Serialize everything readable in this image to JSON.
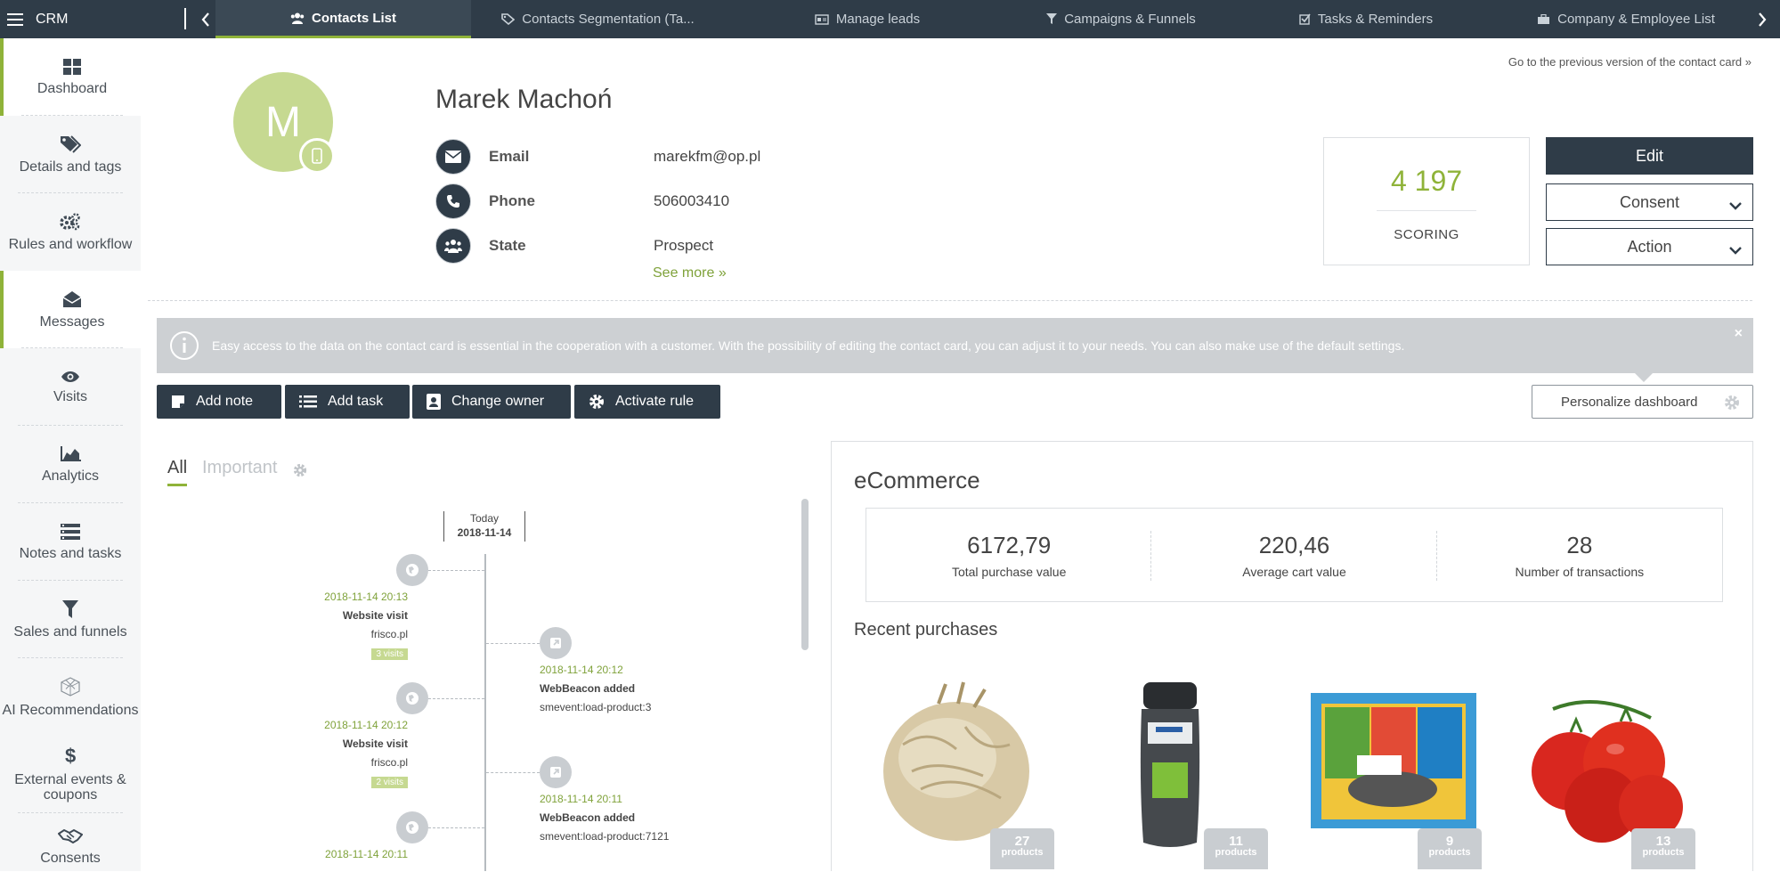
{
  "topbar": {
    "brand": "CRM",
    "tabs": [
      {
        "label": "Contacts List",
        "icon": "users-icon",
        "active": true
      },
      {
        "label": "Contacts Segmentation (Ta...",
        "icon": "tags-icon",
        "active": false
      },
      {
        "label": "Manage leads",
        "icon": "id-card-icon",
        "active": false
      },
      {
        "label": "Campaigns & Funnels",
        "icon": "filter-icon",
        "active": false
      },
      {
        "label": "Tasks & Reminders",
        "icon": "checkbox-icon",
        "active": false
      },
      {
        "label": "Company & Employee List",
        "icon": "briefcase-icon",
        "active": false
      }
    ]
  },
  "sidebar": {
    "items": [
      {
        "label": "Dashboard",
        "icon": "dashboard-icon",
        "active": true
      },
      {
        "label": "Details and tags",
        "icon": "tags-icon",
        "active": false
      },
      {
        "label": "Rules and workflow",
        "icon": "gears-icon",
        "active": false
      },
      {
        "label": "Messages",
        "icon": "envelope-icon",
        "active": true
      },
      {
        "label": "Visits",
        "icon": "eye-icon",
        "active": false
      },
      {
        "label": "Analytics",
        "icon": "area-chart-icon",
        "active": false
      },
      {
        "label": "Notes and tasks",
        "icon": "list-icon",
        "active": false
      },
      {
        "label": "Sales and funnels",
        "icon": "funnel-icon",
        "active": false
      },
      {
        "label": "AI Recommendations",
        "icon": "ai-icon",
        "active": false
      },
      {
        "label": "External events & coupons",
        "icon": "dollar-icon",
        "active": false
      },
      {
        "label": "Consents",
        "icon": "handshake-icon",
        "active": false
      }
    ]
  },
  "contact": {
    "initial": "M",
    "name": "Marek Machoń",
    "fields": [
      {
        "label": "Email",
        "value": "marekfm@op.pl",
        "icon": "envelope-icon"
      },
      {
        "label": "Phone",
        "value": "506003410",
        "icon": "phone-icon"
      },
      {
        "label": "State",
        "value": "Prospect",
        "icon": "group-icon"
      }
    ],
    "see_more": "See more »"
  },
  "prev_version_link": "Go to the previous version of the contact card »",
  "scoring": {
    "value": "4 197",
    "label": "SCORING"
  },
  "buttons": {
    "edit": "Edit",
    "consent": "Consent",
    "action": "Action"
  },
  "info": {
    "text": "Easy access to the data on the contact card is essential in the cooperation with a customer. With the possibility of editing the contact card, you can adjust it to your needs. You can also make use of the default settings.",
    "close": "×"
  },
  "actions": [
    {
      "label": "Add note",
      "icon": "note-icon"
    },
    {
      "label": "Add task",
      "icon": "tasklist-icon"
    },
    {
      "label": "Change owner",
      "icon": "user-card-icon"
    },
    {
      "label": "Activate rule",
      "icon": "gear-icon"
    }
  ],
  "personalize": "Personalize dashboard",
  "filters": {
    "all": "All",
    "important": "Important"
  },
  "timeline": {
    "today_label": "Today",
    "today_date": "2018-11-14",
    "events": [
      {
        "side": "left",
        "datetime": "2018-11-14 20:13",
        "title": "Website visit",
        "detail": "frisco.pl",
        "badge": "3 visits"
      },
      {
        "side": "right",
        "datetime": "2018-11-14 20:12",
        "title": "WebBeacon added",
        "detail": "smevent:load-product:3",
        "badge": ""
      },
      {
        "side": "left",
        "datetime": "2018-11-14 20:12",
        "title": "Website visit",
        "detail": "frisco.pl",
        "badge": "2 visits"
      },
      {
        "side": "right",
        "datetime": "2018-11-14 20:11",
        "title": "WebBeacon added",
        "detail": "smevent:load-product:7121",
        "badge": ""
      },
      {
        "side": "left",
        "datetime": "2018-11-14 20:11",
        "title": "",
        "detail": "",
        "badge": ""
      }
    ]
  },
  "ecommerce": {
    "title": "eCommerce",
    "stats": [
      {
        "value": "6172,79",
        "label": "Total purchase value"
      },
      {
        "value": "220,46",
        "label": "Average cart value"
      },
      {
        "value": "28",
        "label": "Number of transactions"
      }
    ],
    "recent_title": "Recent purchases",
    "products": [
      {
        "name": "celeriac",
        "count": "27",
        "unit": "products"
      },
      {
        "name": "shower gel",
        "count": "11",
        "unit": "products"
      },
      {
        "name": "sponges",
        "count": "9",
        "unit": "products"
      },
      {
        "name": "tomatoes",
        "count": "13",
        "unit": "products"
      }
    ]
  },
  "colors": {
    "navy": "#2f3c48",
    "accent": "#8fb339",
    "avatar": "#c6d991"
  }
}
